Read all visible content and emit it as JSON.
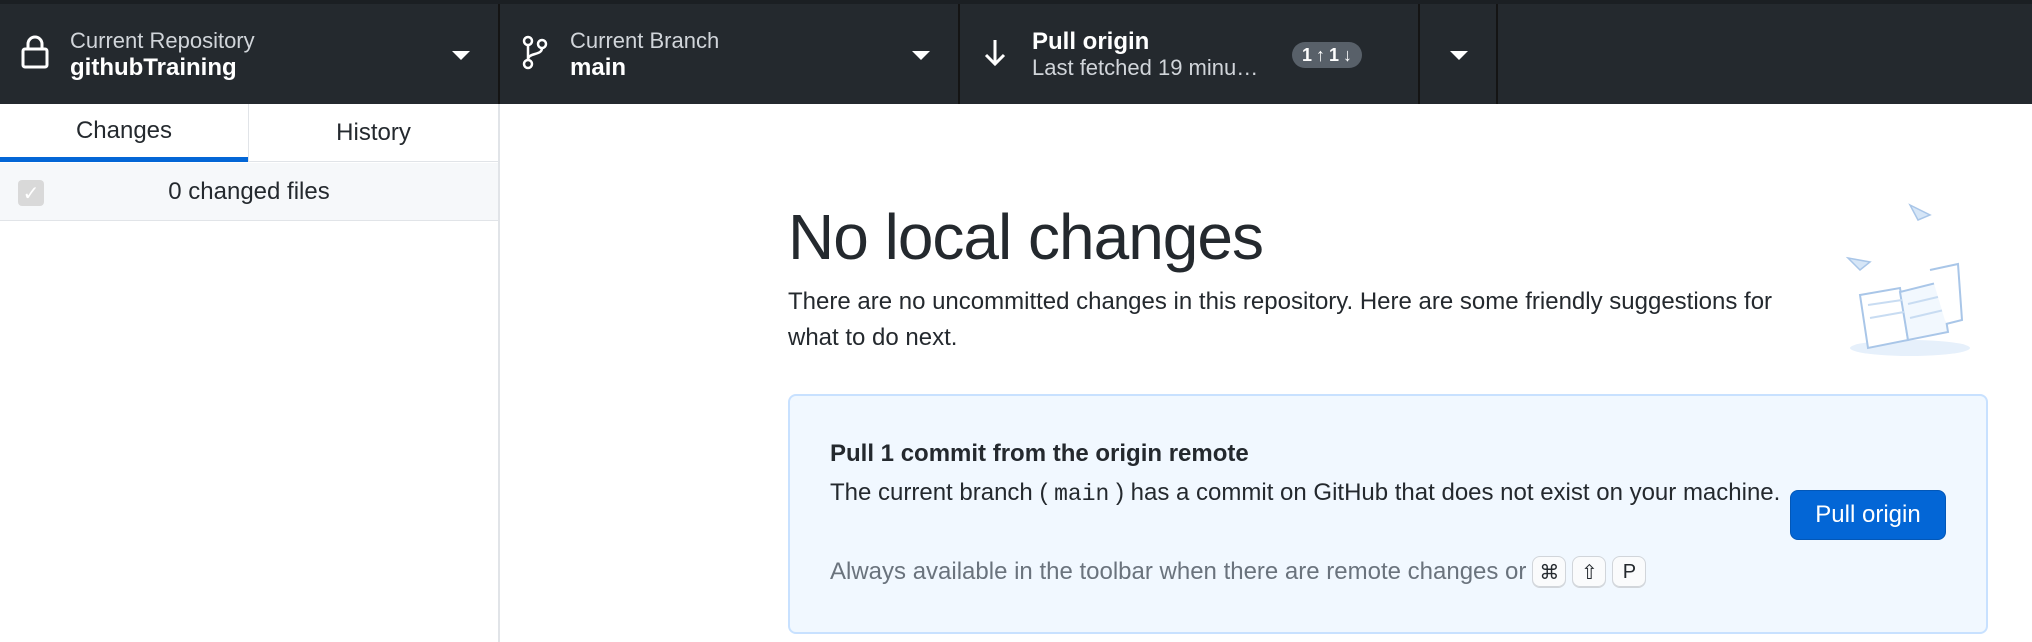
{
  "toolbar": {
    "repository": {
      "label": "Current Repository",
      "value": "githubTraining",
      "icon": "lock-icon"
    },
    "branch": {
      "label": "Current Branch",
      "value": "main",
      "icon": "git-branch-icon"
    },
    "pull": {
      "label": "Pull origin",
      "value": "Last fetched 19 minu…",
      "icon": "arrow-down-icon",
      "ahead": "1",
      "behind": "1"
    },
    "more": {
      "icon": "chevron-down-icon"
    }
  },
  "sidebar": {
    "tabs": [
      {
        "label": "Changes",
        "selected": true
      },
      {
        "label": "History",
        "selected": false
      }
    ],
    "changed_files_label": "0 changed files"
  },
  "main": {
    "heading": "No local changes",
    "subtext": "There are no uncommitted changes in this repository. Here are some friendly suggestions for what to do next.",
    "card": {
      "title": "Pull 1 commit from the origin remote",
      "desc_before": "The current branch (",
      "desc_branch": "main",
      "desc_after": ") has a commit on GitHub that does not exist on your machine.",
      "hint": "Always available in the toolbar when there are remote changes or",
      "shortcut_keys": [
        "⌘",
        "⇧",
        "P"
      ],
      "button_label": "Pull origin"
    }
  },
  "colors": {
    "toolbar_bg": "#24292e",
    "accent": "#0366d6",
    "card_bg": "#f1f8ff",
    "card_border": "#c8e1ff"
  }
}
